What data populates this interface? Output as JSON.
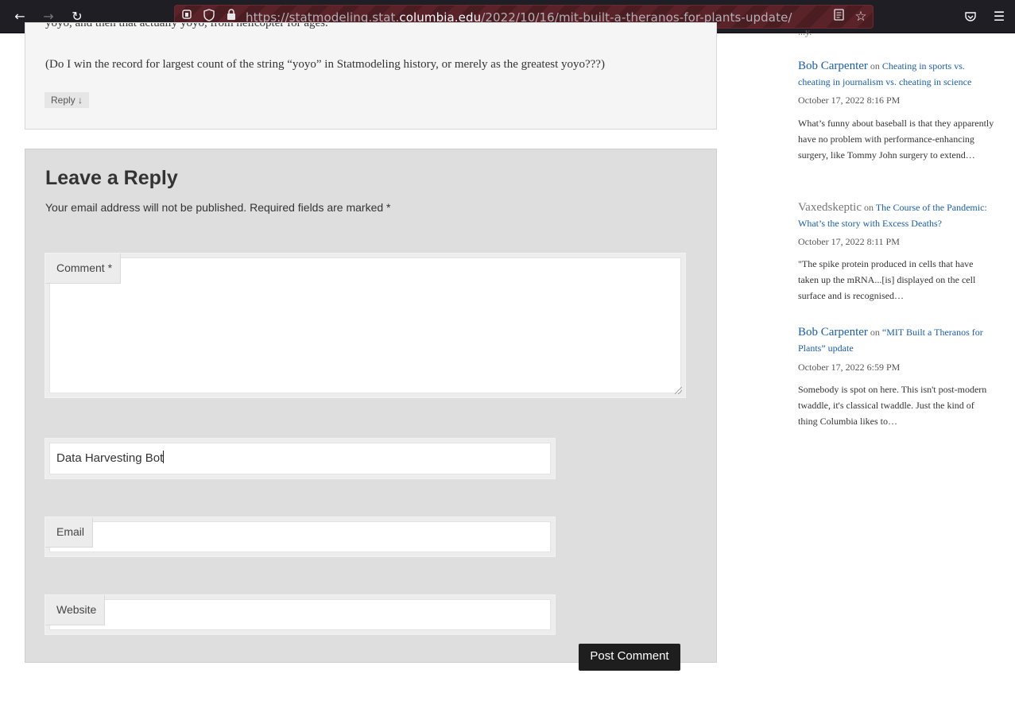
{
  "browser": {
    "url_prefix": "https://statmodeling.stat.",
    "url_domain": "columbia.edu",
    "url_path": "/2022/10/16/mit-built-a-theranos-for-plants-update/",
    "icons": [
      "back-icon",
      "forward-icon",
      "reload-icon",
      "tracking-icon",
      "shield-icon",
      "lock-icon",
      "reader-icon",
      "bookmark-star-icon",
      "pocket-icon",
      "menu-icon"
    ]
  },
  "comment": {
    "cut_text": "yoyo, and then that actually yoyo, from helicopter for ages.",
    "text": "(Do I win the record for largest count of the string “yoyo” in Statmodeling history, or merely as the greatest yoyo???)",
    "reply_label": "Reply ↓"
  },
  "reply_form": {
    "title": "Leave a Reply",
    "notes": "Your email address will not be published. Required fields are marked *",
    "comment_label": "Comment *",
    "comment_value": "",
    "name_value": "Data Harvesting Bot",
    "email_label": "Email",
    "email_value": "",
    "website_label": "Website",
    "website_value": "",
    "submit_label": "Post Comment"
  },
  "sidebar": {
    "cut_text": "...y.",
    "items": [
      {
        "author": "Bob Carpenter",
        "on": "on",
        "post": "Cheating in sports vs. cheating in journalism vs. cheating in science",
        "date": "October 17, 2022 8:16 PM",
        "excerpt": "What’s funny about baseball is that they apparently have no problem with performance-enhancing surgery, like Tommy John surgery to extend…"
      },
      {
        "author": "Vaxedskeptic",
        "on": "on",
        "post": "The Course of the Pandemic: What’s the story with Excess Deaths?",
        "date": "October 17, 2022 8:11 PM",
        "excerpt": "\"The spike protein produced in cells that have taken up the mRNA...[is] displayed on the cell surface and is recognised…"
      },
      {
        "author": "Bob Carpenter",
        "on": "on",
        "post": "“MIT Built a Theranos for Plants” update",
        "date": "October 17, 2022 6:59 PM",
        "excerpt": "Somebody is spot on here. This isn't post-modern twaddle, it's classical twaddle. Just the kind of thing Columbia likes to…"
      }
    ]
  },
  "colors": {
    "link": "#1a5ea8",
    "form_bg": "#dedede",
    "button": "#1e1e1e"
  }
}
